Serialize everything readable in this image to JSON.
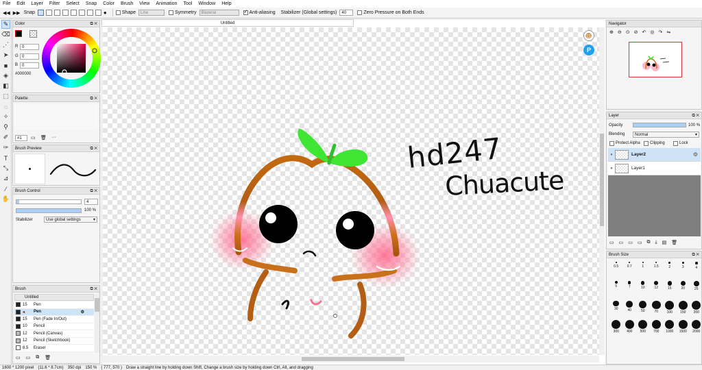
{
  "menu": [
    "File",
    "Edit",
    "Layer",
    "Filter",
    "Select",
    "Snap",
    "Color",
    "Brush",
    "View",
    "Animation",
    "Tool",
    "Window",
    "Help"
  ],
  "toolbar": {
    "snap_label": "Snap",
    "shape_label": "Shape",
    "shape_value": "Line",
    "symmetry_label": "Symmetry",
    "symmetry_value": "Bilateral",
    "antialias_label": "Anti-aliasing",
    "stabilizer_label": "Stabilizer (Global settings)",
    "stabilizer_value": "40",
    "zero_pressure_label": "Zero Pressure on Both Ends"
  },
  "document_tab": "Untitled",
  "color_panel": {
    "title": "Color",
    "r_label": "R",
    "r_value": "0",
    "g_label": "G",
    "g_value": "0",
    "b_label": "B",
    "b_value": "0",
    "hex": "#000000",
    "primary": "#000000"
  },
  "palette_panel": {
    "title": "Palette",
    "selector": "#1",
    "more": "···"
  },
  "brush_preview": {
    "title": "Brush Preview"
  },
  "brush_control": {
    "title": "Brush Control",
    "size_value": "4",
    "size_fraction": 0.04,
    "opacity_value": "100",
    "opacity_unit": "%",
    "opacity_fraction": 1.0,
    "stabilizer_label": "Stabilizer",
    "stabilizer_value": "Use global settings"
  },
  "brush_panel": {
    "title": "Brush",
    "group": "Untitled",
    "items": [
      {
        "size": "15",
        "name": "Pen"
      },
      {
        "size": "",
        "name": "Pen"
      },
      {
        "size": "15",
        "name": "Pen (Fade In/Out)"
      },
      {
        "size": "10",
        "name": "Pencil"
      },
      {
        "size": "12",
        "name": "Pencil (Canvas)"
      },
      {
        "size": "12",
        "name": "Pencil (Sketchbook)"
      },
      {
        "size": "8.5",
        "name": "Eraser"
      }
    ]
  },
  "navigator": {
    "title": "Navigator"
  },
  "layer_panel": {
    "title": "Layer",
    "opacity_label": "Opacity",
    "opacity_value": "100",
    "opacity_unit": "%",
    "opacity_fraction": 1.0,
    "blending_label": "Blending",
    "blending_value": "Normal",
    "protect_alpha": "Protect Alpha",
    "clipping": "Clipping",
    "lock": "Lock",
    "layers": [
      "Layer2",
      "Layer1"
    ]
  },
  "brush_size_panel": {
    "title": "Brush Size",
    "sizes": [
      "0.5",
      "0.7",
      "1",
      "1.5",
      "2",
      "3",
      "4",
      "5",
      "7",
      "10",
      "12",
      "15",
      "20",
      "25",
      "30",
      "40",
      "50",
      "70",
      "100",
      "150",
      "200",
      "300",
      "400",
      "500",
      "700",
      "1000",
      "1500",
      "2000"
    ]
  },
  "artwork": {
    "line1": "hd247",
    "line2": "Chuacute"
  },
  "status": {
    "dimensions": "1600 * 1200 pixel",
    "physical": "(11.6 * 8.7cm)",
    "dpi": "350 dpi",
    "zoom": "150 %",
    "coords": "( 777, 570 )",
    "hint": "Draw a straight line by holding down Shift, Change a brush size by holding down Ctrl, Alt, and dragging"
  },
  "colors": {
    "accent": "#3a7dc9",
    "selection": "#cfe3f7",
    "sprout": "#35d62b",
    "stem": "#b8640c",
    "blush": "#ff6f92"
  }
}
